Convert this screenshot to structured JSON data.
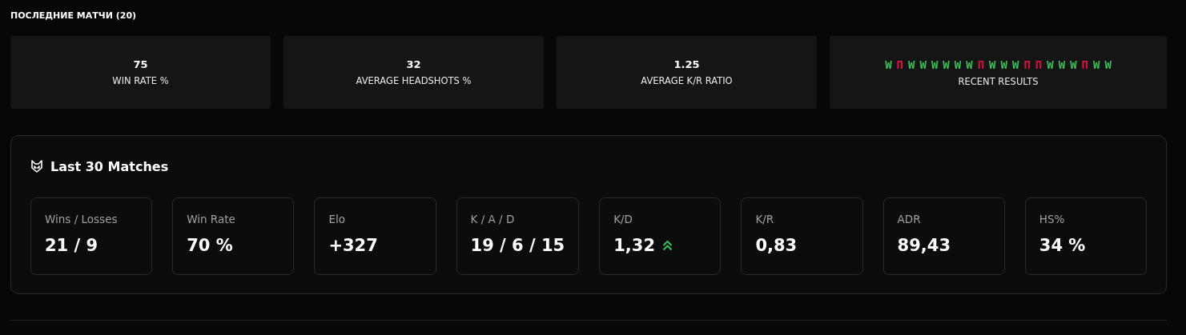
{
  "section_title": "ПОСЛЕДНИЕ МАТЧИ (20)",
  "summary_cards": [
    {
      "value": "75",
      "label": "WIN RATE %"
    },
    {
      "value": "32",
      "label": "AVERAGE HEADSHOTS %"
    },
    {
      "value": "1.25",
      "label": "AVERAGE K/R RATIO"
    }
  ],
  "recent_results": {
    "label": "RECENT RESULTS",
    "results": [
      {
        "text": "W",
        "kind": "win"
      },
      {
        "text": "П",
        "kind": "loss"
      },
      {
        "text": "W",
        "kind": "win"
      },
      {
        "text": "W",
        "kind": "win"
      },
      {
        "text": "W",
        "kind": "win"
      },
      {
        "text": "W",
        "kind": "win"
      },
      {
        "text": "W",
        "kind": "win"
      },
      {
        "text": "W",
        "kind": "win"
      },
      {
        "text": "П",
        "kind": "loss"
      },
      {
        "text": "W",
        "kind": "win"
      },
      {
        "text": "W",
        "kind": "win"
      },
      {
        "text": "W",
        "kind": "win"
      },
      {
        "text": "П",
        "kind": "loss"
      },
      {
        "text": "П",
        "kind": "loss"
      },
      {
        "text": "W",
        "kind": "win"
      },
      {
        "text": "W",
        "kind": "win"
      },
      {
        "text": "W",
        "kind": "win"
      },
      {
        "text": "П",
        "kind": "loss"
      },
      {
        "text": "W",
        "kind": "win"
      },
      {
        "text": "W",
        "kind": "win"
      }
    ]
  },
  "panel": {
    "title": "Last 30 Matches",
    "stats": [
      {
        "label": "Wins / Losses",
        "value": "21 / 9"
      },
      {
        "label": "Win Rate",
        "value": "70 %"
      },
      {
        "label": "Elo",
        "value": "+327"
      },
      {
        "label": "K / A / D",
        "value": "19 / 6 / 15"
      },
      {
        "label": "K/D",
        "value": "1,32",
        "trend_up": true
      },
      {
        "label": "K/R",
        "value": "0,83"
      },
      {
        "label": "ADR",
        "value": "89,43"
      },
      {
        "label": "HS%",
        "value": "34 %"
      }
    ]
  }
}
